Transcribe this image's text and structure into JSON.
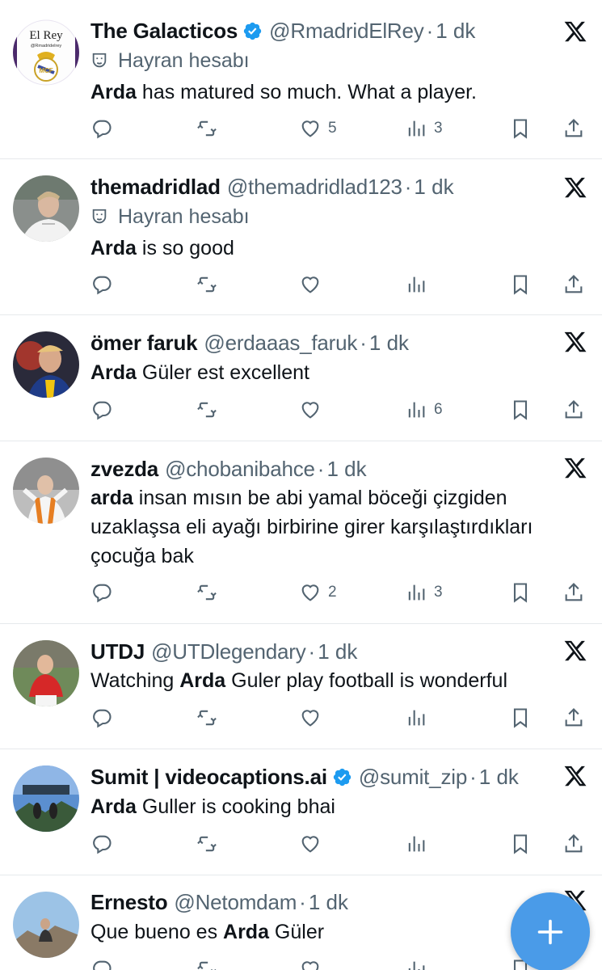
{
  "tweets": [
    {
      "name": "The Galacticos",
      "verified": true,
      "handle": "@RmadridElRey",
      "time": "1 dk",
      "fan_label": "Hayran hesabı",
      "text_bold": "Arda",
      "text_rest": " has matured so much. What a player.",
      "avatar_text": "El Rey",
      "avatar_subtext": "@Rmadridelrey",
      "likes": "5",
      "views": "3"
    },
    {
      "name": "themadridlad",
      "verified": false,
      "handle": "@themadridlad123",
      "time": "1 dk",
      "fan_label": "Hayran hesabı",
      "text_bold": "Arda",
      "text_rest": " is so good",
      "likes": "",
      "views": ""
    },
    {
      "name": "ömer faruk",
      "verified": false,
      "handle": "@erdaaas_faruk",
      "time": "1 dk",
      "text_bold": "Arda",
      "text_rest": " Güler est excellent",
      "likes": "",
      "views": "6"
    },
    {
      "name": "zvezda",
      "verified": false,
      "handle": "@chobanibahce",
      "time": "1 dk",
      "text_bold": "arda",
      "text_rest": " insan mısın be abi yamal böceği çizgiden uzaklaşsa eli ayağı birbirine girer karşılaştırdıkları çocuğa bak",
      "likes": "2",
      "views": "3"
    },
    {
      "name": "UTDJ",
      "verified": false,
      "handle": "@UTDlegendary",
      "time": "1 dk",
      "text_pre": "Watching ",
      "text_bold": "Arda",
      "text_rest": " Guler play football is wonderful",
      "likes": "",
      "views": ""
    },
    {
      "name": "Sumit | videocaptions.ai",
      "verified": true,
      "handle": "@sumit_zip",
      "time": "1 dk",
      "text_bold": "Arda",
      "text_rest": " Guller is cooking bhai",
      "likes": "",
      "views": ""
    },
    {
      "name": "Ernesto",
      "verified": false,
      "handle": "@Netomdam",
      "time": "1 dk",
      "text_pre": "Que bueno es ",
      "text_bold": "Arda",
      "text_rest": " Güler",
      "likes": "",
      "views": ""
    }
  ],
  "dot_separator": "·",
  "colors": {
    "accent": "#1d9bf0",
    "fab": "#4a9be8",
    "secondary_text": "#536471",
    "divider": "#e6e9ec"
  },
  "icons": {
    "reply": "reply-icon",
    "retweet": "retweet-icon",
    "like": "heart-icon",
    "views": "views-icon",
    "bookmark": "bookmark-icon",
    "share": "share-icon",
    "x": "x-logo-icon",
    "fan": "theater-mask-icon",
    "compose": "plus-icon"
  }
}
